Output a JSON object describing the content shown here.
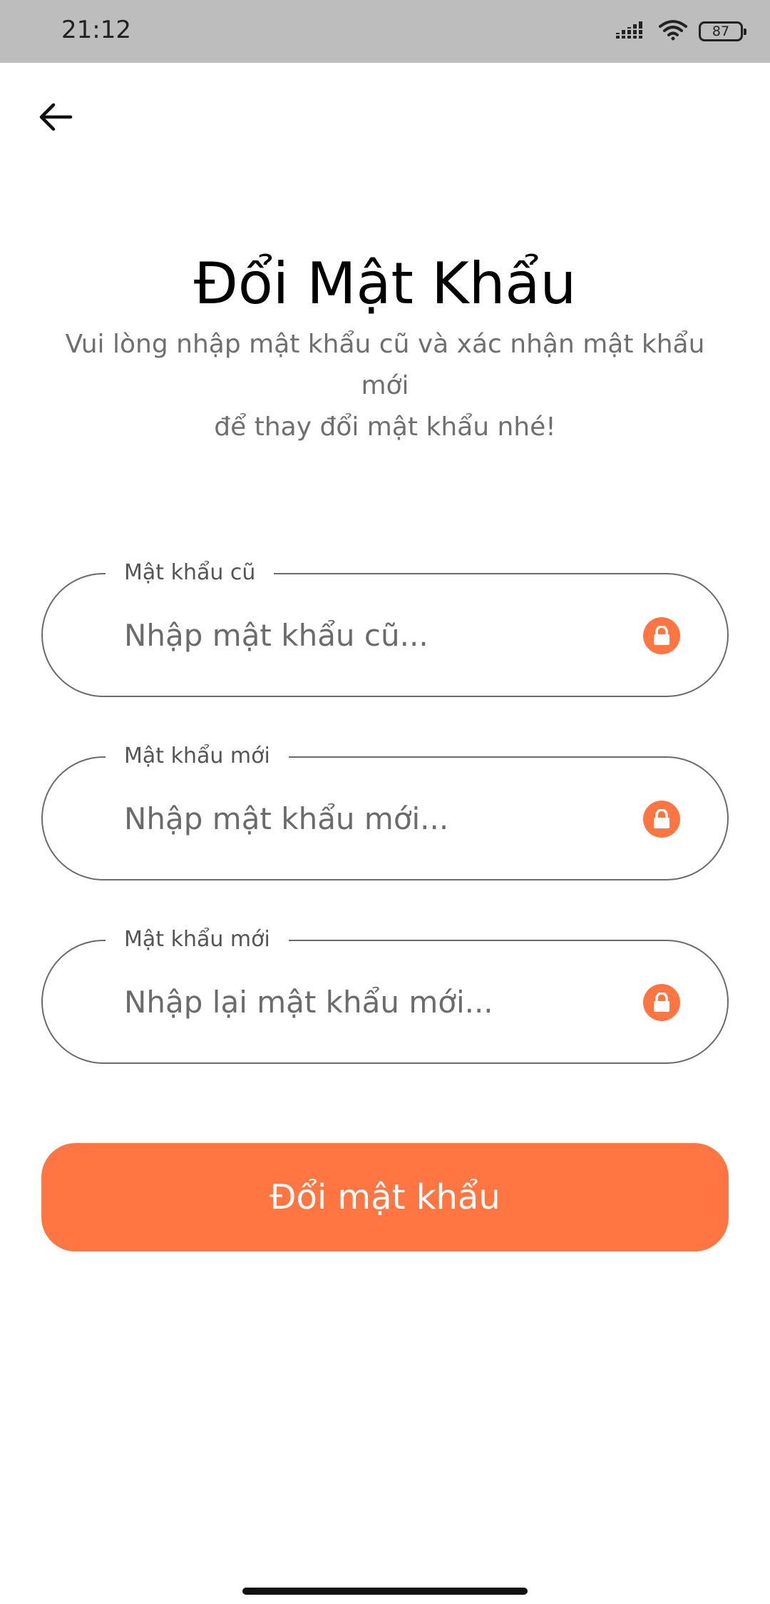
{
  "status_bar": {
    "time": "21:12",
    "battery": "87",
    "icons": [
      "signal-icon",
      "wifi-icon",
      "battery-icon"
    ]
  },
  "header": {
    "back_icon": "arrow-left-icon"
  },
  "main": {
    "title": "Đổi Mật Khẩu",
    "subtitle_lines": [
      "Vui lòng nhập mật khẩu cũ và xác nhận mật khẩu",
      "mới",
      "để thay đổi mật khẩu nhé!"
    ]
  },
  "form": {
    "fields": [
      {
        "label": "Mật khẩu cũ",
        "placeholder": "Nhập mật khẩu cũ...",
        "value": "",
        "icon": "lock-icon"
      },
      {
        "label": "Mật khẩu mới",
        "placeholder": "Nhập mật khẩu mới...",
        "value": "",
        "icon": "lock-icon"
      },
      {
        "label": "Mật khẩu mới",
        "placeholder": "Nhập lại mật khẩu mới...",
        "value": "",
        "icon": "lock-icon"
      }
    ],
    "submit_label": "Đổi mật khẩu"
  },
  "colors": {
    "accent": "#ff7643",
    "status_bar": "#bdbdbd",
    "border": "#6b6b6b",
    "subtitle_text": "#6f6f6f"
  }
}
